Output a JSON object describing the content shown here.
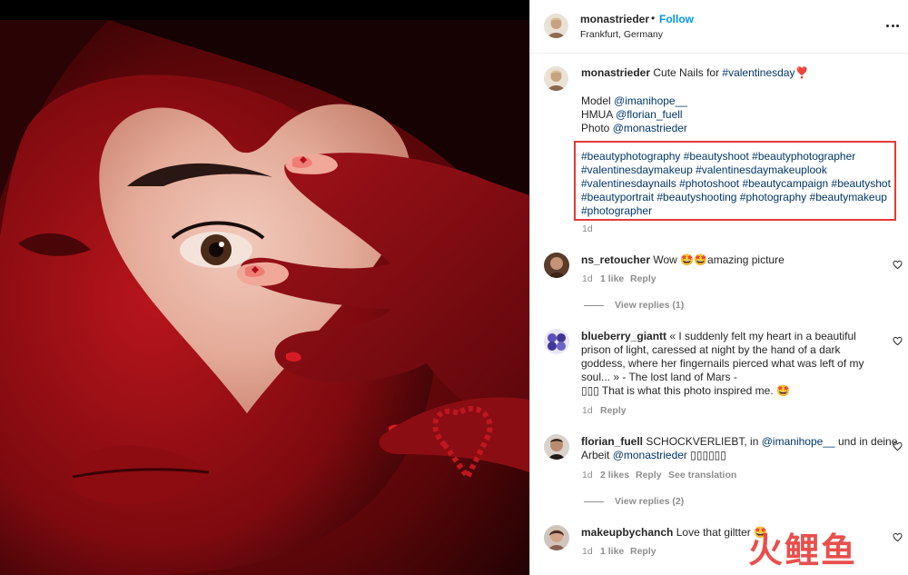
{
  "post": {
    "username": "monastrieder",
    "separator": "•",
    "follow_label": "Follow",
    "location": "Frankfurt, Germany",
    "more_icon": "more-horizontal-icon"
  },
  "caption": {
    "username": "monastrieder",
    "text": "Cute Nails for",
    "hashtag_title": "#valentinesday",
    "emoji": "❣️",
    "credits": [
      {
        "label": "Model",
        "handle": "@imanihope__"
      },
      {
        "label": "HMUA",
        "handle": "@florian_fuell"
      },
      {
        "label": "Photo",
        "handle": "@monastrieder"
      }
    ],
    "hashtag_lines": [
      "#beautyphotography #beautyshoot #beautyphotographer",
      "#valentinesdaymakeup #valentinesdaymakeuplook",
      "#valentinesdaynails #photoshoot #beautycampaign #beautyshot",
      "#beautyportrait #beautyshooting #photography #beautymakeup",
      "#photographer"
    ],
    "time": "1d"
  },
  "comments": [
    {
      "username": "ns_retoucher",
      "text": "Wow 🤩🤩amazing picture",
      "time": "1d",
      "likes": "1 like",
      "reply": "Reply",
      "view_replies": "View replies (1)"
    },
    {
      "username": "blueberry_giantt",
      "lines": [
        "« I suddenly felt my heart in a beautiful",
        "prison of light, caressed at night by the hand of a dark",
        "goddess, where her fingernails pierced what was left of my",
        "soul... » - The lost land of Mars -",
        "▯▯▯ That is what this photo inspired me. 🤩"
      ],
      "time": "1d",
      "reply": "Reply"
    },
    {
      "username": "florian_fuell",
      "text_before": "SCHOCKVERLIEBT, in",
      "mention_1": "@imanihope__",
      "text_middle": "und in deine",
      "text_line2_start": "Arbeit",
      "mention_2": "@monastrieder",
      "text_end": "▯▯▯▯▯▯",
      "time": "1d",
      "likes": "2 likes",
      "reply": "Reply",
      "see_translation": "See translation",
      "view_replies": "View replies (2)"
    },
    {
      "username": "makeupbychanch",
      "text": "Love that giltter 🤩",
      "time": "1d",
      "likes": "1 like",
      "reply": "Reply"
    }
  ],
  "watermark": "火鲤鱼",
  "colors": {
    "link": "#00376b",
    "follow": "#0095f6",
    "highlight": "#e53935",
    "muted": "#8e8e8e"
  }
}
